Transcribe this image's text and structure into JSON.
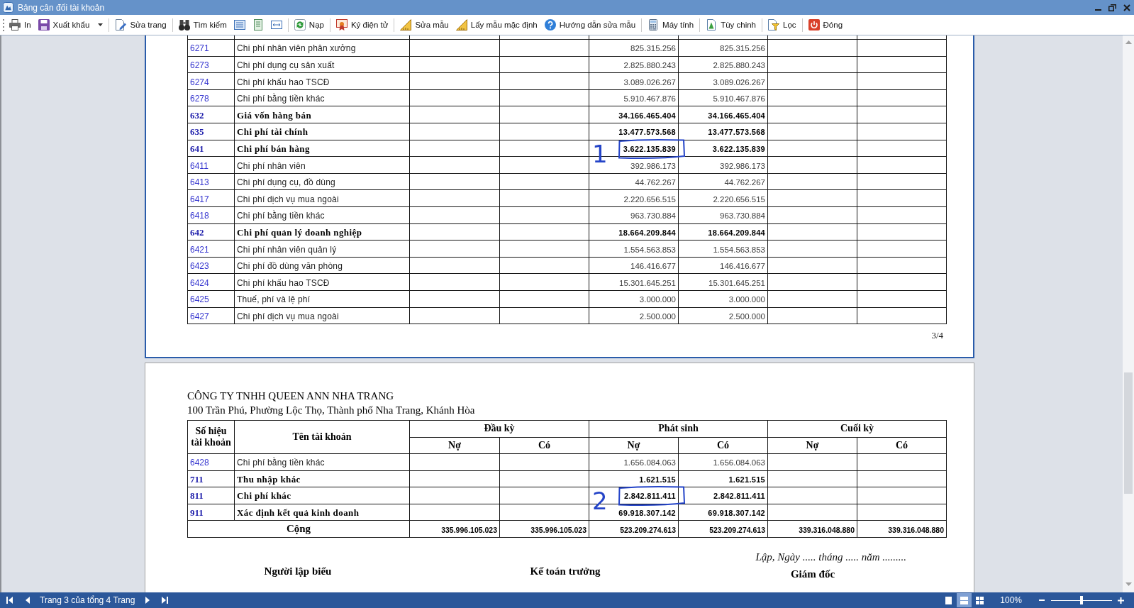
{
  "window": {
    "title": "Bảng cân đối tài khoản"
  },
  "toolbar": [
    [
      {
        "kind": "labeled",
        "label": "In"
      },
      {
        "kind": "labeled",
        "label": "Xuất khẩu",
        "has_menu": true
      }
    ],
    [
      {
        "kind": "labeled",
        "label": "Sửa trang"
      }
    ],
    [
      {
        "kind": "labeled",
        "label": "Tìm kiếm"
      },
      {
        "kind": "icon_only"
      },
      {
        "kind": "icon_only"
      },
      {
        "kind": "icon_only"
      }
    ],
    [
      {
        "kind": "labeled",
        "label": "Nạp"
      }
    ],
    [
      {
        "kind": "labeled",
        "label": "Ký điện tử"
      }
    ],
    [
      {
        "kind": "labeled",
        "label": "Sửa mẫu"
      },
      {
        "kind": "labeled",
        "label": "Lấy mẫu mặc định"
      },
      {
        "kind": "labeled",
        "label": "Hướng dẫn sửa mẫu"
      }
    ],
    [
      {
        "kind": "labeled",
        "label": "Máy tính"
      }
    ],
    [
      {
        "kind": "labeled",
        "label": "Tùy chinh"
      }
    ],
    [
      {
        "kind": "labeled",
        "label": "Lọc"
      }
    ],
    [
      {
        "kind": "labeled",
        "label": "Đóng"
      }
    ]
  ],
  "page_3": {
    "rows": [
      {
        "kind": "detail",
        "account": "6271",
        "name": "Chi phí nhân viên phân xưởng",
        "period_debit": "825.315.256",
        "period_credit": "825.315.256"
      },
      {
        "kind": "detail",
        "account": "6273",
        "name": "Chi phí dụng cụ sản xuất",
        "period_debit": "2.825.880.243",
        "period_credit": "2.825.880.243"
      },
      {
        "kind": "detail",
        "account": "6274",
        "name": "Chi phí khấu hao TSCĐ",
        "period_debit": "3.089.026.267",
        "period_credit": "3.089.026.267"
      },
      {
        "kind": "detail",
        "account": "6278",
        "name": "Chi phí bằng tiền khác",
        "period_debit": "5.910.467.876",
        "period_credit": "5.910.467.876"
      },
      {
        "kind": "summary",
        "account": "632",
        "name": "Giá vốn hàng bán",
        "period_debit": "34.166.465.404",
        "period_credit": "34.166.465.404"
      },
      {
        "kind": "summary",
        "account": "635",
        "name": "Chi phí tài chính",
        "period_debit": "13.477.573.568",
        "period_credit": "13.477.573.568"
      },
      {
        "kind": "summary",
        "account": "641",
        "name": "Chi phí bán hàng",
        "period_debit": "3.622.135.839",
        "period_credit": "3.622.135.839",
        "annotation": {
          "label": "1"
        }
      },
      {
        "kind": "detail",
        "account": "6411",
        "name": "Chi phí nhân viên",
        "period_debit": "392.986.173",
        "period_credit": "392.986.173"
      },
      {
        "kind": "detail",
        "account": "6413",
        "name": "Chi phí dụng cụ, đồ dùng",
        "period_debit": "44.762.267",
        "period_credit": "44.762.267"
      },
      {
        "kind": "detail",
        "account": "6417",
        "name": "Chi phí dịch vụ mua ngoài",
        "period_debit": "2.220.656.515",
        "period_credit": "2.220.656.515"
      },
      {
        "kind": "detail",
        "account": "6418",
        "name": "Chi phí bằng tiền khác",
        "period_debit": "963.730.884",
        "period_credit": "963.730.884"
      },
      {
        "kind": "summary",
        "account": "642",
        "name": "Chi phí quản lý doanh nghiệp",
        "period_debit": "18.664.209.844",
        "period_credit": "18.664.209.844"
      },
      {
        "kind": "detail",
        "account": "6421",
        "name": "Chi phí nhân viên quản lý",
        "period_debit": "1.554.563.853",
        "period_credit": "1.554.563.853"
      },
      {
        "kind": "detail",
        "account": "6423",
        "name": "Chi phí đồ dùng văn phòng",
        "period_debit": "146.416.677",
        "period_credit": "146.416.677"
      },
      {
        "kind": "detail",
        "account": "6424",
        "name": "Chi phí khấu hao TSCĐ",
        "period_debit": "15.301.645.251",
        "period_credit": "15.301.645.251"
      },
      {
        "kind": "detail",
        "account": "6425",
        "name": "Thuế, phí và lệ phí",
        "period_debit": "3.000.000",
        "period_credit": "3.000.000"
      },
      {
        "kind": "detail",
        "account": "6427",
        "name": "Chi phí dịch vụ mua ngoài",
        "period_debit": "2.500.000",
        "period_credit": "2.500.000"
      }
    ],
    "page_number": "3/4"
  },
  "page_4": {
    "company": "CÔNG TY TNHH QUEEN ANN NHA TRANG",
    "address": "100 Trần Phú, Phường Lộc Thọ, Thành phố Nha Trang, Khánh Hòa",
    "table": {
      "columns": {
        "account": "Số hiệu tài khoản",
        "name": "Tên tài khoản",
        "groups": [
          {
            "label": "Đầu kỳ",
            "debit": "Nợ",
            "credit": "Có"
          },
          {
            "label": "Phát sinh",
            "debit": "Nợ",
            "credit": "Có"
          },
          {
            "label": "Cuối kỳ",
            "debit": "Nợ",
            "credit": "Có"
          }
        ]
      },
      "rows": [
        {
          "kind": "detail",
          "account": "6428",
          "name": "Chi phí bằng tiền khác",
          "period_debit": "1.656.084.063",
          "period_credit": "1.656.084.063"
        },
        {
          "kind": "summary",
          "account": "711",
          "name": "Thu nhập khác",
          "period_debit": "1.621.515",
          "period_credit": "1.621.515"
        },
        {
          "kind": "summary",
          "account": "811",
          "name": "Chi phí khác",
          "period_debit": "2.842.811.411",
          "period_credit": "2.842.811.411",
          "annotation": {
            "label": "2"
          }
        },
        {
          "kind": "summary",
          "account": "911",
          "name": "Xác định kết quả kinh doanh",
          "period_debit": "69.918.307.142",
          "period_credit": "69.918.307.142"
        }
      ],
      "total": {
        "label": "Cộng",
        "opening_debit": "335.996.105.023",
        "opening_credit": "335.996.105.023",
        "period_debit": "523.209.274.613",
        "period_credit": "523.209.274.613",
        "closing_debit": "339.316.048.880",
        "closing_credit": "339.316.048.880"
      }
    },
    "date_line": "Lập, Ngày ..... tháng ..... năm .........",
    "signatures": [
      "Người lập biểu",
      "Kế toán trưởng",
      "Giám đốc"
    ]
  },
  "status_bar": {
    "page_info": "Trang 3 của tổng 4 Trang",
    "view_modes": [
      {
        "selected": false
      },
      {
        "selected": true
      },
      {
        "selected": false
      }
    ],
    "zoom_label": "100%",
    "zoom_slider": {
      "level": 0.5
    }
  }
}
